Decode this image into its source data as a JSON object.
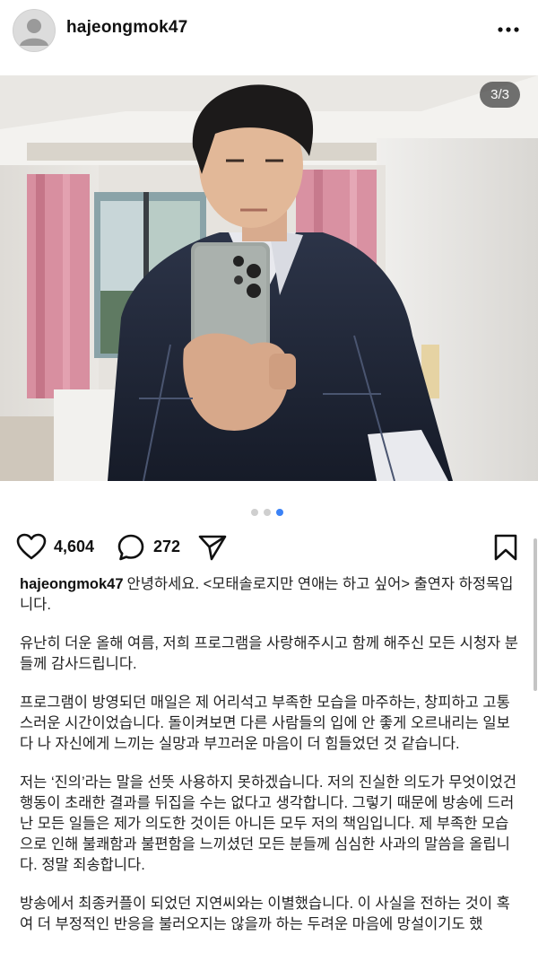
{
  "header": {
    "username": "hajeongmok47",
    "more_icon": "more-horizontal-icon"
  },
  "photo": {
    "counter": "3/3",
    "carousel_total": 3,
    "carousel_active": 3
  },
  "actions": {
    "like_icon": "heart-icon",
    "like_count": "4,604",
    "comment_icon": "comment-icon",
    "comment_count": "272",
    "share_icon": "send-icon",
    "save_icon": "bookmark-icon"
  },
  "caption": {
    "username": "hajeongmok47",
    "intro": "안녕하세요. <모태솔로지만 연애는 하고 싶어> 출연자 하정목입니다.",
    "p1": "유난히 더운 올해 여름, 저희 프로그램을 사랑해주시고 함께 해주신 모든 시청자 분들께 감사드립니다.",
    "p2": "프로그램이 방영되던 매일은 제 어리석고 부족한 모습을 마주하는, 창피하고 고통스러운 시간이었습니다. 돌이켜보면 다른 사람들의 입에 안 좋게 오르내리는 일보다 나 자신에게 느끼는 실망과 부끄러운 마음이 더 힘들었던 것 같습니다.",
    "p3": "저는 ‘진의’라는 말을 선뜻 사용하지 못하겠습니다. 저의 진실한 의도가 무엇이었건 행동이 초래한 결과를 뒤집을 수는 없다고 생각합니다. 그렇기 때문에 방송에 드러난 모든 일들은 제가 의도한 것이든 아니든 모두 저의 책임입니다. 제 부족한 모습으로 인해 불쾌함과 불편함을 느끼셨던 모든 분들께 심심한 사과의 말씀을 올립니다. 정말 죄송합니다.",
    "p4": "방송에서 최종커플이 되었던 지연씨와는 이별했습니다. 이 사실을 전하는 것이 혹여 더 부정적인 반응을 불러오지는 않을까 하는 두려운 마음에 망설이기도 했"
  }
}
